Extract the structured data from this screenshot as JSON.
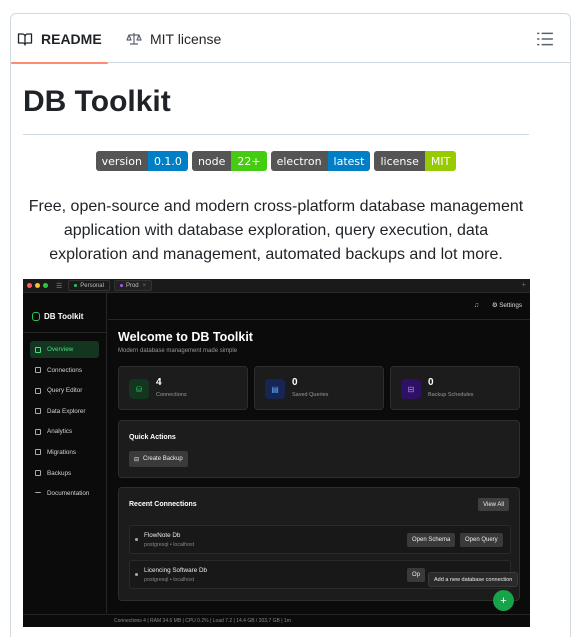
{
  "tabs": {
    "readme": "README",
    "license": "MIT license"
  },
  "readme": {
    "title": "DB Toolkit",
    "badges": [
      {
        "key": "version",
        "value": "0.1.0",
        "color": "#007ec6"
      },
      {
        "key": "node",
        "value": "22+",
        "color": "#4c1"
      },
      {
        "key": "electron",
        "value": "latest",
        "color": "#007ec6"
      },
      {
        "key": "license",
        "value": "MIT",
        "color": "#97ca00"
      }
    ],
    "description": "Free, open-source and modern cross-platform database management application with database exploration, query execution, data exploration and management, automated backups and lot more."
  },
  "app": {
    "window_tabs": [
      {
        "label": "Personal",
        "color": "#22c55e"
      },
      {
        "label": "Prod",
        "color": "#a855f7"
      }
    ],
    "brand": "DB Toolkit",
    "nav": [
      "Overview",
      "Connections",
      "Query Editor",
      "Data Explorer",
      "Analytics",
      "Migrations",
      "Backups",
      "Documentation"
    ],
    "settings_label": "Settings",
    "welcome_title": "Welcome to DB Toolkit",
    "welcome_sub": "Modern database management made simple",
    "stats": [
      {
        "value": "4",
        "label": "Connections",
        "color": "#22c55e",
        "bg": "#14351f",
        "icon": "database-icon"
      },
      {
        "value": "0",
        "label": "Saved Queries",
        "color": "#3b82f6",
        "bg": "#172554",
        "icon": "file-icon"
      },
      {
        "value": "0",
        "label": "Backup Schedules",
        "color": "#a855f7",
        "bg": "#2e1065",
        "icon": "hard-drive-icon"
      }
    ],
    "quick_actions_title": "Quick Actions",
    "create_backup": "Create Backup",
    "recent_title": "Recent Connections",
    "view_all": "View All",
    "connections": [
      {
        "name": "FlowNote Db",
        "meta": "postgresql • localhost",
        "open_schema": "Open Schema",
        "open_query": "Open Query"
      },
      {
        "name": "Licencing Software Db",
        "meta": "postgresql • localhost",
        "open_schema": "Op"
      }
    ],
    "tooltip": "Add a new database connection",
    "fab_label": "+",
    "status": "Connections 4  |  RAM 34.6 MB  |  CPU 0.2%  |  Load 7.2  |  14.4 GB / 203.7 GB  |  1m"
  }
}
